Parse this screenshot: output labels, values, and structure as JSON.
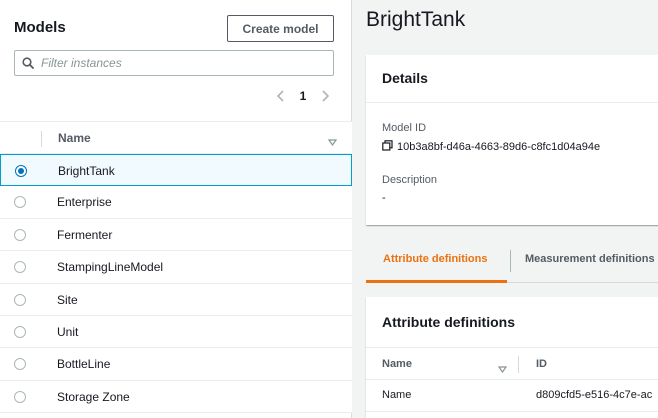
{
  "models_panel": {
    "title": "Models",
    "create_button": "Create model",
    "filter": {
      "placeholder": "Filter instances",
      "value": ""
    },
    "pagination": {
      "current_page": "1"
    },
    "table": {
      "column_header": "Name",
      "rows": [
        {
          "label": "BrightTank",
          "selected": true
        },
        {
          "label": "Enterprise",
          "selected": false
        },
        {
          "label": "Fermenter",
          "selected": false
        },
        {
          "label": "StampingLineModel",
          "selected": false
        },
        {
          "label": "Site",
          "selected": false
        },
        {
          "label": "Unit",
          "selected": false
        },
        {
          "label": "BottleLine",
          "selected": false
        },
        {
          "label": "Storage Zone",
          "selected": false
        }
      ]
    }
  },
  "detail": {
    "title": "BrightTank",
    "details_card": {
      "heading": "Details",
      "model_id_label": "Model ID",
      "model_id_value": "10b3a8bf-d46a-4663-89d6-c8fc1d04a94e",
      "description_label": "Description",
      "description_value": "-"
    },
    "tabs": [
      {
        "label": "Attribute definitions",
        "active": true
      },
      {
        "label": "Measurement definitions",
        "active": false
      }
    ],
    "attributes_card": {
      "heading": "Attribute definitions",
      "columns": [
        "Name",
        "ID"
      ],
      "rows": [
        {
          "name": "Name",
          "id": "d809cfd5-e516-4c7e-ac"
        }
      ]
    }
  },
  "colors": {
    "accent_orange": "#ec7211",
    "selection_blue": "#0073bb",
    "selection_border": "#00a1c9"
  }
}
